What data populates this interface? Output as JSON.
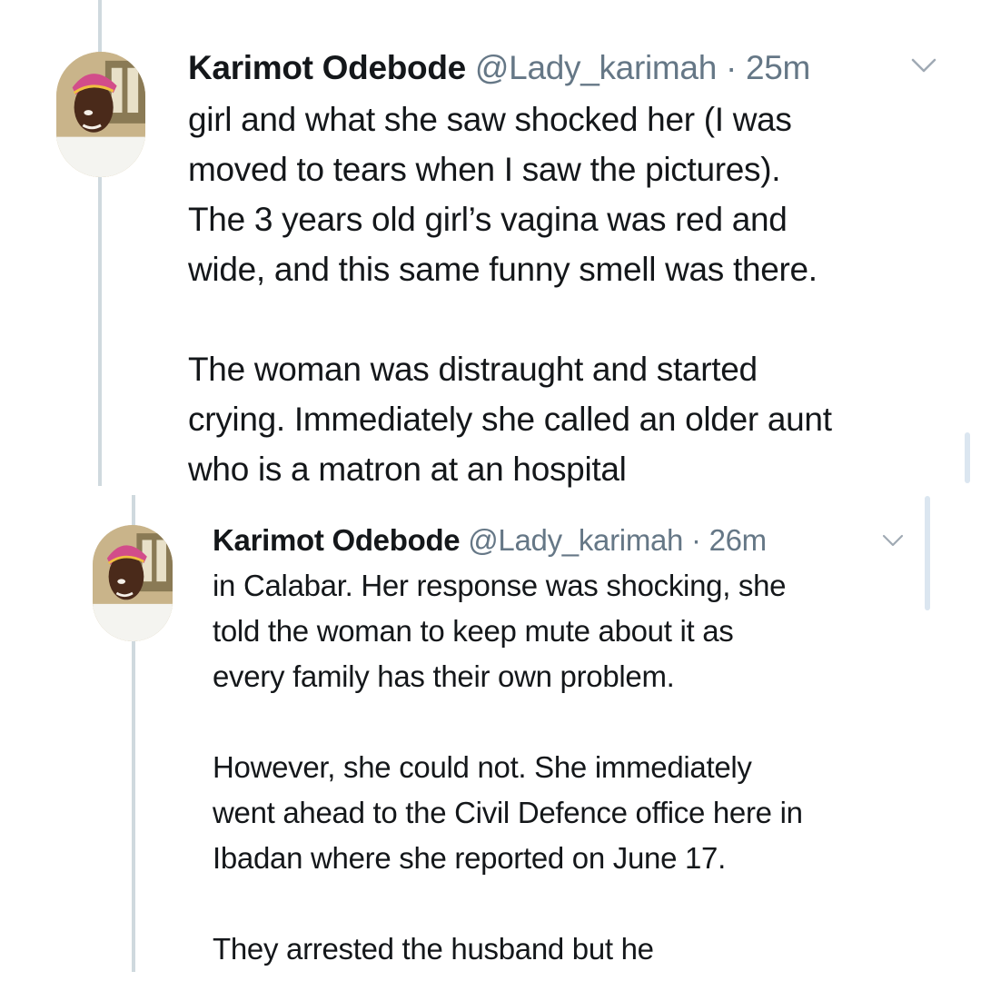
{
  "tweets": [
    {
      "author_name": "Karimot Odebode",
      "handle": "@Lady_karimah",
      "separator": "·",
      "time": "25m",
      "lines": [
        "girl and what she saw shocked her (I was",
        "moved to tears when I saw the pictures).",
        "The 3 years old girl’s vagina was red and",
        "wide, and this same funny smell was there.",
        "",
        "The woman was distraught and started",
        "crying. Immediately she called an older aunt",
        "who is a matron at an hospital"
      ]
    },
    {
      "author_name": "Karimot Odebode",
      "handle": "@Lady_karimah",
      "separator": "·",
      "time": "26m",
      "lines": [
        "in Calabar. Her response was shocking, she",
        "told the woman to keep mute about it as",
        "every family has their own problem.",
        "",
        "However, she could not. She immediately",
        "went ahead to the Civil Defence office here in",
        "Ibadan where she reported on June 17.",
        "",
        "They arrested the husband but he"
      ]
    }
  ],
  "icons": {
    "menu": "chevron-down-icon",
    "avatar": "avatar"
  },
  "colors": {
    "text": "#14171a",
    "secondary": "#657786",
    "thread_line": "#cfd9de",
    "background": "#ffffff"
  }
}
